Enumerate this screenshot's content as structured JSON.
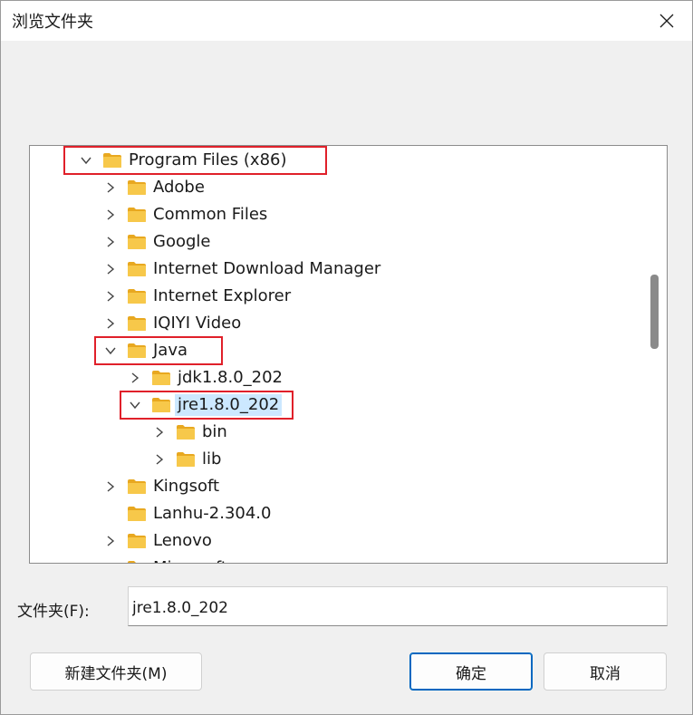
{
  "dialog": {
    "title": "浏览文件夹",
    "close_icon": "close-icon"
  },
  "tree": {
    "items": [
      {
        "label": "Program Files (x86)",
        "level": 0,
        "expanded": true,
        "expander": true,
        "selected": false
      },
      {
        "label": "Adobe",
        "level": 1,
        "expanded": false,
        "expander": true,
        "selected": false
      },
      {
        "label": "Common Files",
        "level": 1,
        "expanded": false,
        "expander": true,
        "selected": false
      },
      {
        "label": "Google",
        "level": 1,
        "expanded": false,
        "expander": true,
        "selected": false
      },
      {
        "label": "Internet Download Manager",
        "level": 1,
        "expanded": false,
        "expander": true,
        "selected": false
      },
      {
        "label": "Internet Explorer",
        "level": 1,
        "expanded": false,
        "expander": true,
        "selected": false
      },
      {
        "label": "IQIYI Video",
        "level": 1,
        "expanded": false,
        "expander": true,
        "selected": false
      },
      {
        "label": "Java",
        "level": 1,
        "expanded": true,
        "expander": true,
        "selected": false
      },
      {
        "label": "jdk1.8.0_202",
        "level": 2,
        "expanded": false,
        "expander": true,
        "selected": false
      },
      {
        "label": "jre1.8.0_202",
        "level": 2,
        "expanded": true,
        "expander": true,
        "selected": true
      },
      {
        "label": "bin",
        "level": 3,
        "expanded": false,
        "expander": true,
        "selected": false
      },
      {
        "label": "lib",
        "level": 3,
        "expanded": false,
        "expander": true,
        "selected": false
      },
      {
        "label": "Kingsoft",
        "level": 1,
        "expanded": false,
        "expander": true,
        "selected": false
      },
      {
        "label": "Lanhu-2.304.0",
        "level": 1,
        "expanded": false,
        "expander": false,
        "selected": false
      },
      {
        "label": "Lenovo",
        "level": 1,
        "expanded": false,
        "expander": true,
        "selected": false
      },
      {
        "label": "Microsoft",
        "level": 1,
        "expanded": false,
        "expander": true,
        "selected": false
      }
    ],
    "highlighted": [
      "Program Files (x86)",
      "Java",
      "jre1.8.0_202"
    ]
  },
  "folder_field": {
    "label": "文件夹(F):",
    "value": "jre1.8.0_202"
  },
  "buttons": {
    "new_folder": "新建文件夹(M)",
    "ok": "确定",
    "cancel": "取消"
  },
  "colors": {
    "highlight_box": "#e0202a",
    "selection": "#cce8ff",
    "folder": "#f7c84a",
    "accent": "#0067c0"
  }
}
